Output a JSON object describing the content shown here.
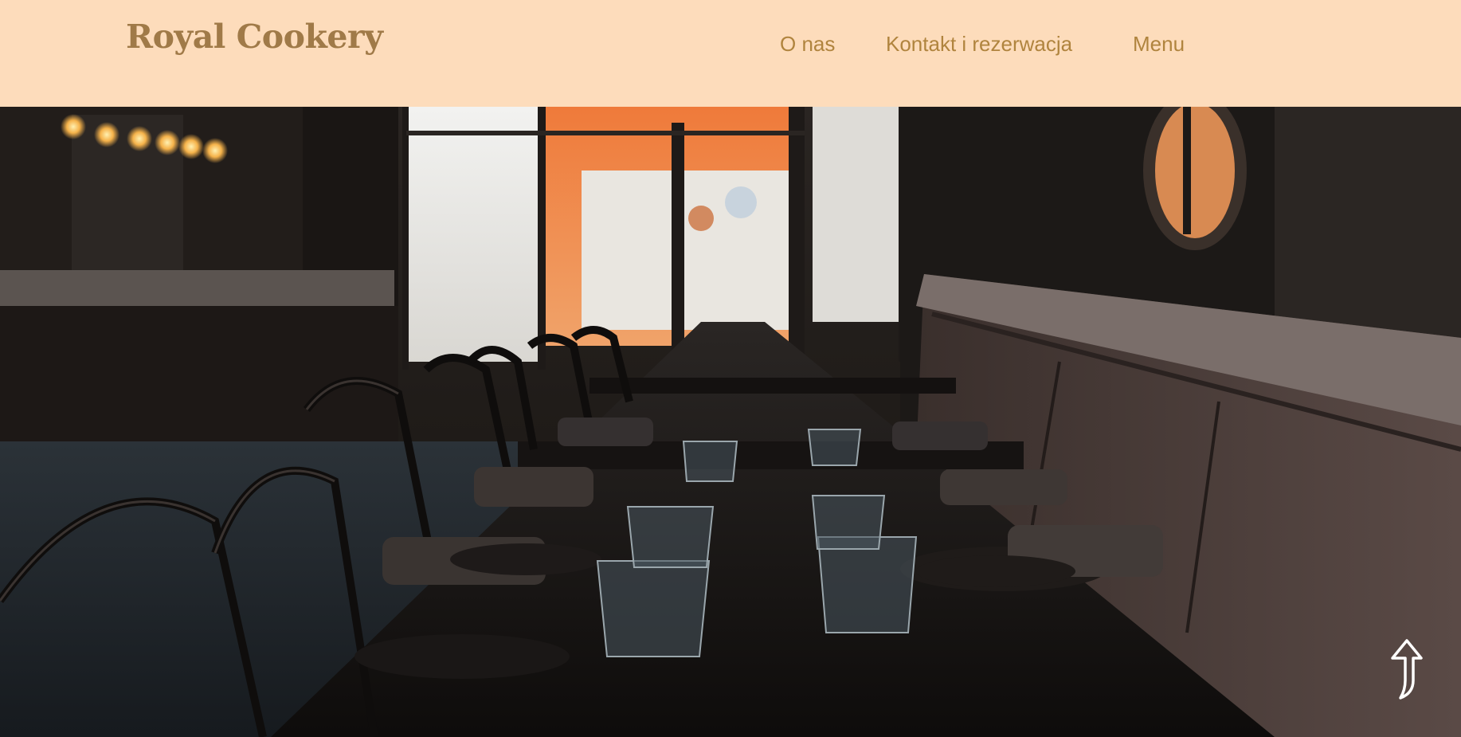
{
  "header": {
    "logo": "Royal Cookery",
    "nav": [
      {
        "label": "O nas"
      },
      {
        "label": "Kontakt i rezerwacja"
      },
      {
        "label": "Menu"
      }
    ],
    "background_color": "#fddcbb",
    "brand_color": "#a07a48",
    "link_color": "#b0843e"
  },
  "hero": {
    "image": "restaurant-interior-photo"
  },
  "scroll_top": {
    "icon": "arrow-up-icon"
  }
}
